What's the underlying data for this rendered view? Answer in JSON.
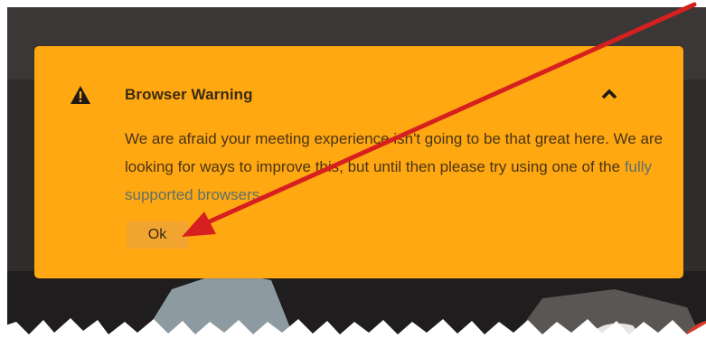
{
  "dialog": {
    "title": "Browser Warning",
    "message_before_link": "We are afraid your meeting experience isn't going to be that great here. We are looking for ways to improve this, but until then please try using one of the ",
    "link_text": "fully supported browsers",
    "message_after_link": ".",
    "ok_label": "Ok"
  },
  "icons": {
    "warning": "warning-triangle-icon",
    "collapse": "chevron-up-icon"
  },
  "colors": {
    "panel_background": "#ffa811",
    "ok_button_background": "#f2a431",
    "link_color": "#5f6f6a",
    "annotation_arrow": "#d62020"
  }
}
